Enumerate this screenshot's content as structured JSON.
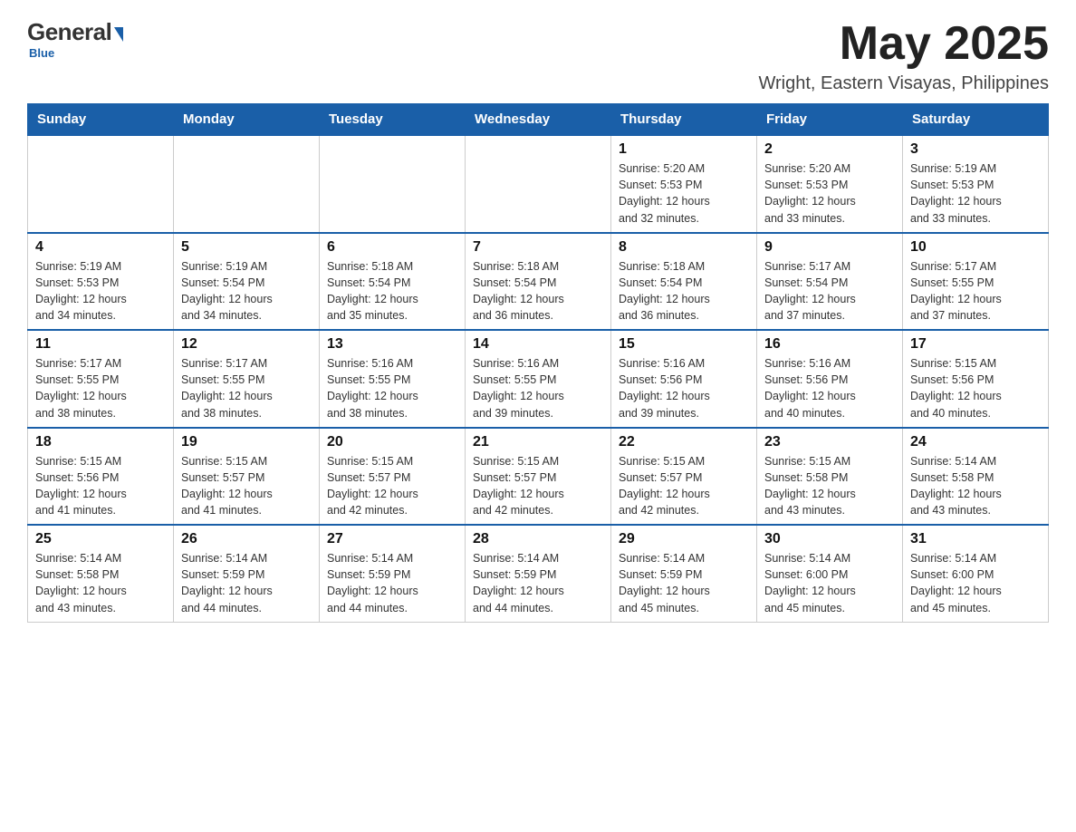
{
  "header": {
    "logo": {
      "general": "General",
      "blue": "Blue"
    },
    "title": "May 2025",
    "location": "Wright, Eastern Visayas, Philippines"
  },
  "calendar": {
    "days_of_week": [
      "Sunday",
      "Monday",
      "Tuesday",
      "Wednesday",
      "Thursday",
      "Friday",
      "Saturday"
    ],
    "weeks": [
      [
        {
          "day": "",
          "info": ""
        },
        {
          "day": "",
          "info": ""
        },
        {
          "day": "",
          "info": ""
        },
        {
          "day": "",
          "info": ""
        },
        {
          "day": "1",
          "info": "Sunrise: 5:20 AM\nSunset: 5:53 PM\nDaylight: 12 hours\nand 32 minutes."
        },
        {
          "day": "2",
          "info": "Sunrise: 5:20 AM\nSunset: 5:53 PM\nDaylight: 12 hours\nand 33 minutes."
        },
        {
          "day": "3",
          "info": "Sunrise: 5:19 AM\nSunset: 5:53 PM\nDaylight: 12 hours\nand 33 minutes."
        }
      ],
      [
        {
          "day": "4",
          "info": "Sunrise: 5:19 AM\nSunset: 5:53 PM\nDaylight: 12 hours\nand 34 minutes."
        },
        {
          "day": "5",
          "info": "Sunrise: 5:19 AM\nSunset: 5:54 PM\nDaylight: 12 hours\nand 34 minutes."
        },
        {
          "day": "6",
          "info": "Sunrise: 5:18 AM\nSunset: 5:54 PM\nDaylight: 12 hours\nand 35 minutes."
        },
        {
          "day": "7",
          "info": "Sunrise: 5:18 AM\nSunset: 5:54 PM\nDaylight: 12 hours\nand 36 minutes."
        },
        {
          "day": "8",
          "info": "Sunrise: 5:18 AM\nSunset: 5:54 PM\nDaylight: 12 hours\nand 36 minutes."
        },
        {
          "day": "9",
          "info": "Sunrise: 5:17 AM\nSunset: 5:54 PM\nDaylight: 12 hours\nand 37 minutes."
        },
        {
          "day": "10",
          "info": "Sunrise: 5:17 AM\nSunset: 5:55 PM\nDaylight: 12 hours\nand 37 minutes."
        }
      ],
      [
        {
          "day": "11",
          "info": "Sunrise: 5:17 AM\nSunset: 5:55 PM\nDaylight: 12 hours\nand 38 minutes."
        },
        {
          "day": "12",
          "info": "Sunrise: 5:17 AM\nSunset: 5:55 PM\nDaylight: 12 hours\nand 38 minutes."
        },
        {
          "day": "13",
          "info": "Sunrise: 5:16 AM\nSunset: 5:55 PM\nDaylight: 12 hours\nand 38 minutes."
        },
        {
          "day": "14",
          "info": "Sunrise: 5:16 AM\nSunset: 5:55 PM\nDaylight: 12 hours\nand 39 minutes."
        },
        {
          "day": "15",
          "info": "Sunrise: 5:16 AM\nSunset: 5:56 PM\nDaylight: 12 hours\nand 39 minutes."
        },
        {
          "day": "16",
          "info": "Sunrise: 5:16 AM\nSunset: 5:56 PM\nDaylight: 12 hours\nand 40 minutes."
        },
        {
          "day": "17",
          "info": "Sunrise: 5:15 AM\nSunset: 5:56 PM\nDaylight: 12 hours\nand 40 minutes."
        }
      ],
      [
        {
          "day": "18",
          "info": "Sunrise: 5:15 AM\nSunset: 5:56 PM\nDaylight: 12 hours\nand 41 minutes."
        },
        {
          "day": "19",
          "info": "Sunrise: 5:15 AM\nSunset: 5:57 PM\nDaylight: 12 hours\nand 41 minutes."
        },
        {
          "day": "20",
          "info": "Sunrise: 5:15 AM\nSunset: 5:57 PM\nDaylight: 12 hours\nand 42 minutes."
        },
        {
          "day": "21",
          "info": "Sunrise: 5:15 AM\nSunset: 5:57 PM\nDaylight: 12 hours\nand 42 minutes."
        },
        {
          "day": "22",
          "info": "Sunrise: 5:15 AM\nSunset: 5:57 PM\nDaylight: 12 hours\nand 42 minutes."
        },
        {
          "day": "23",
          "info": "Sunrise: 5:15 AM\nSunset: 5:58 PM\nDaylight: 12 hours\nand 43 minutes."
        },
        {
          "day": "24",
          "info": "Sunrise: 5:14 AM\nSunset: 5:58 PM\nDaylight: 12 hours\nand 43 minutes."
        }
      ],
      [
        {
          "day": "25",
          "info": "Sunrise: 5:14 AM\nSunset: 5:58 PM\nDaylight: 12 hours\nand 43 minutes."
        },
        {
          "day": "26",
          "info": "Sunrise: 5:14 AM\nSunset: 5:59 PM\nDaylight: 12 hours\nand 44 minutes."
        },
        {
          "day": "27",
          "info": "Sunrise: 5:14 AM\nSunset: 5:59 PM\nDaylight: 12 hours\nand 44 minutes."
        },
        {
          "day": "28",
          "info": "Sunrise: 5:14 AM\nSunset: 5:59 PM\nDaylight: 12 hours\nand 44 minutes."
        },
        {
          "day": "29",
          "info": "Sunrise: 5:14 AM\nSunset: 5:59 PM\nDaylight: 12 hours\nand 45 minutes."
        },
        {
          "day": "30",
          "info": "Sunrise: 5:14 AM\nSunset: 6:00 PM\nDaylight: 12 hours\nand 45 minutes."
        },
        {
          "day": "31",
          "info": "Sunrise: 5:14 AM\nSunset: 6:00 PM\nDaylight: 12 hours\nand 45 minutes."
        }
      ]
    ]
  }
}
